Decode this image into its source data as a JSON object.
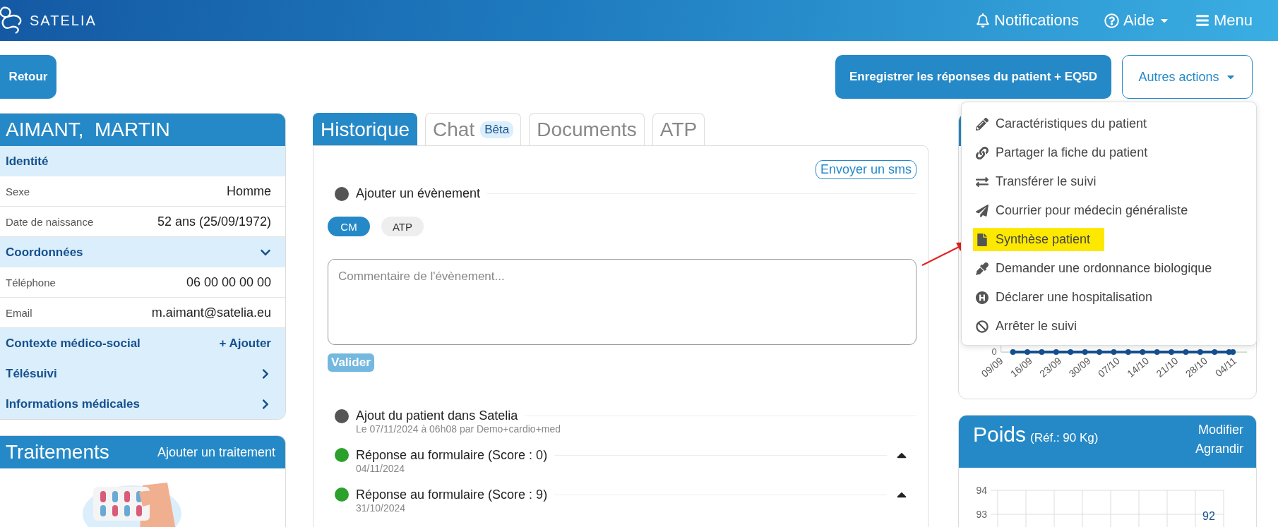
{
  "header": {
    "brand": "SATELIA",
    "nav": [
      {
        "label": "Notifications",
        "kind": "bell"
      },
      {
        "label": "Aide",
        "kind": "help"
      },
      {
        "label": "Menu",
        "kind": "menu"
      }
    ]
  },
  "actions": {
    "back": "Retour",
    "primary": "Enregistrer les réponses du patient + EQ5D",
    "more": {
      "label": "Autres actions",
      "expanded": true,
      "items": [
        {
          "label": "Caractéristiques du patient",
          "highlighted": false
        },
        {
          "label": "Partager la fiche du patient",
          "highlighted": false
        },
        {
          "label": "Transférer le suivi",
          "highlighted": false
        },
        {
          "label": "Courrier pour médecin généraliste",
          "highlighted": false
        },
        {
          "label": "Synthèse patient",
          "highlighted": true
        },
        {
          "label": "Demander une ordonnance biologique",
          "highlighted": false
        },
        {
          "label": "Déclarer une hospitalisation",
          "highlighted": false
        },
        {
          "label": "Arrêter le suivi",
          "highlighted": false
        }
      ]
    }
  },
  "patient": {
    "name": "AIMANT,  MARTIN",
    "rows": [
      {
        "kind": "section",
        "label": "Identité"
      },
      {
        "kind": "field",
        "label": "Sexe",
        "value": "Homme"
      },
      {
        "kind": "field",
        "label": "Date de naissance",
        "value": "52 ans (25/09/1972)"
      },
      {
        "kind": "section",
        "label": "Coordonnées",
        "expanded": true
      },
      {
        "kind": "field",
        "label": "Téléphone",
        "value": "06 00 00 00 00"
      },
      {
        "kind": "field",
        "label": "Email",
        "value": "m.aimant@satelia.eu"
      },
      {
        "kind": "section",
        "label": "Contexte médico-social",
        "action": "+ Ajouter"
      },
      {
        "kind": "section",
        "label": "Télésuivi",
        "expanded": false
      },
      {
        "kind": "section",
        "label": "Informations médicales",
        "expanded": false
      }
    ]
  },
  "treatments": {
    "title": "Traitements",
    "action": "Ajouter un traitement"
  },
  "tabs": [
    {
      "label": "Historique",
      "selected": true
    },
    {
      "label": "Chat",
      "badge": "Bêta",
      "selected": false
    },
    {
      "label": "Documents",
      "selected": false
    },
    {
      "label": "ATP",
      "selected": false
    }
  ],
  "history": {
    "sms_button": "Envoyer un sms",
    "add_event": "Ajouter un évènement",
    "event_types": [
      {
        "label": "CM",
        "selected": true
      },
      {
        "label": "ATP",
        "selected": false
      }
    ],
    "comment": {
      "placeholder": "Commentaire de l'évènement..."
    },
    "submit": "Valider",
    "events": [
      {
        "title": "Ajout du patient dans Satelia",
        "subtitle": "Le 07/11/2024 à 06h08 par Demo+cardio+med",
        "color": "#555555"
      },
      {
        "title": "Réponse au formulaire (Score : 0)",
        "subtitle": "04/11/2024",
        "color": "#2ca02c",
        "expanded": true
      },
      {
        "title": "Réponse au formulaire (Score : 9)",
        "subtitle": "31/10/2024",
        "color": "#2ca02c",
        "expanded": true
      }
    ]
  },
  "score_chart": {
    "y_tick": "0",
    "x_labels": [
      "09/09",
      "16/09",
      "23/09",
      "30/09",
      "07/10",
      "14/10",
      "21/10",
      "28/10",
      "04/11"
    ]
  },
  "weight": {
    "title": "Poids",
    "reference": "(Réf.: 90 Kg)",
    "links": [
      "Modifier",
      "Agrandir"
    ],
    "y_ticks": [
      "94",
      "93"
    ],
    "point_label": "92"
  }
}
